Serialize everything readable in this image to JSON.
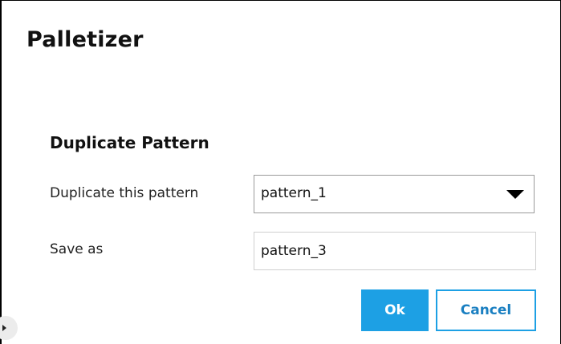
{
  "window": {
    "title": "Palletizer"
  },
  "dialog": {
    "section_title": "Duplicate Pattern",
    "duplicate_label": "Duplicate this pattern",
    "duplicate_selected": "pattern_1",
    "save_as_label": "Save as",
    "save_as_value": "pattern_3",
    "ok_label": "Ok",
    "cancel_label": "Cancel"
  },
  "colors": {
    "accent": "#1da0e4",
    "cancel_text": "#1a7fc1"
  },
  "icons": {
    "dropdown": "triangle-down",
    "side_handle": "triangle-right"
  }
}
